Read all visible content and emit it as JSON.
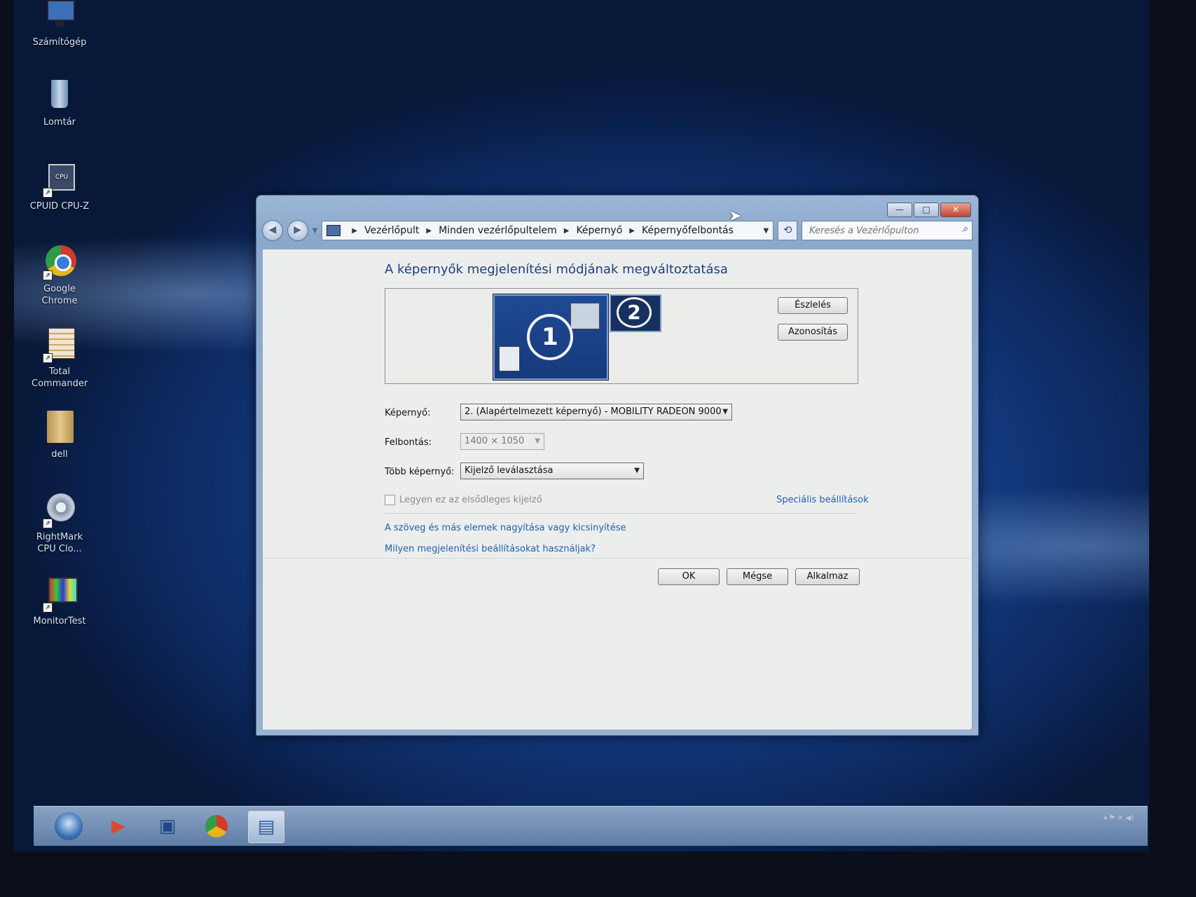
{
  "desktop": {
    "icons": [
      {
        "label": "Számítógép",
        "icon": "computer-icon"
      },
      {
        "label": "Lomtár",
        "icon": "recycle-bin-icon"
      },
      {
        "label": "CPUID CPU-Z",
        "icon": "cpuz-icon"
      },
      {
        "label": "Google Chrome",
        "icon": "chrome-icon"
      },
      {
        "label": "Total Commander",
        "icon": "total-commander-icon"
      },
      {
        "label": "dell",
        "icon": "folder-icon"
      },
      {
        "label": "RightMark CPU Clo...",
        "icon": "rightmark-icon"
      },
      {
        "label": "MonitorTest",
        "icon": "monitortest-icon"
      }
    ]
  },
  "window": {
    "controls": {
      "minimize": "—",
      "maximize": "□",
      "close": "✕"
    },
    "breadcrumb": [
      "Vezérlőpult",
      "Minden vezérlőpultelem",
      "Képernyő",
      "Képernyőfelbontás"
    ],
    "search_placeholder": "Keresés a Vezérlőpulton",
    "title": "A képernyők megjelenítési módjának megváltoztatása",
    "monitors": {
      "primary_number": "1",
      "secondary_number": "2"
    },
    "buttons": {
      "detect": "Észlelés",
      "identify": "Azonosítás"
    },
    "fields": {
      "display_label": "Képernyő:",
      "display_value": "2. (Alapértelmezett képernyő) - MOBILITY RADEON 9000",
      "resolution_label": "Felbontás:",
      "resolution_value": "1400 × 1050",
      "multi_label": "Több képernyő:",
      "multi_value": "Kijelző leválasztása"
    },
    "primary_checkbox_label": "Legyen ez az elsődleges kijelző",
    "advanced_link": "Speciális beállítások",
    "links": [
      "A szöveg és más elemek nagyítása vagy kicsinyítése",
      "Milyen megjelenítési beállításokat használjak?"
    ],
    "dialog_buttons": {
      "ok": "OK",
      "cancel": "Mégse",
      "apply": "Alkalmaz"
    }
  },
  "taskbar": {
    "items": [
      "media-player-icon",
      "save-icon",
      "chrome-icon",
      "display-settings-icon"
    ]
  },
  "colors": {
    "accent": "#1e3f7a",
    "link": "#1f5fb3",
    "desktop": "#16408c"
  }
}
